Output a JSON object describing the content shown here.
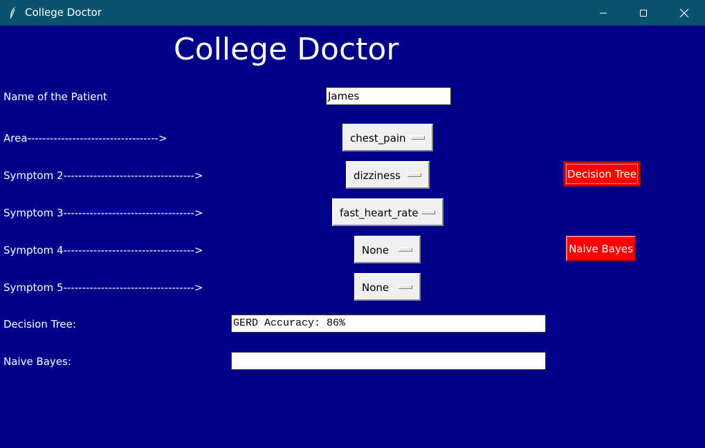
{
  "window": {
    "title": "College Doctor",
    "controls": [
      "minimize-icon",
      "maximize-icon",
      "close-icon"
    ]
  },
  "heading": "College Doctor",
  "form": {
    "name_label": "Name of the Patient",
    "name_value": "James",
    "area_label": "Area----------------------------------->",
    "area_value": "chest_pain",
    "symptom2_label": "Symptom 2----------------------------------->",
    "symptom2_value": "dizziness",
    "symptom3_label": "Symptom 3----------------------------------->",
    "symptom3_value": "fast_heart_rate",
    "symptom4_label": "Symptom 4----------------------------------->",
    "symptom4_value": "None",
    "symptom5_label": "Symptom 5----------------------------------->",
    "symptom5_value": "None"
  },
  "buttons": {
    "decision_tree": "Decision Tree",
    "naive_bayes": "Naive Bayes"
  },
  "results": {
    "decision_tree_label": "Decision Tree:",
    "decision_tree_value": "GERD Accuracy: 86%",
    "naive_bayes_label": "Naive Bayes:",
    "naive_bayes_value": ""
  },
  "colors": {
    "background": "#000088",
    "titlebar": "#0a5370",
    "button": "#ff0000"
  }
}
